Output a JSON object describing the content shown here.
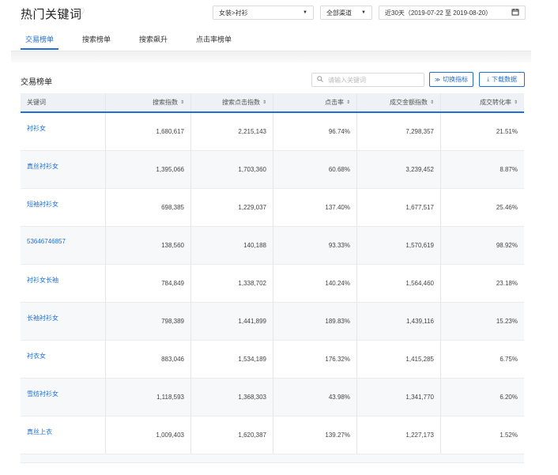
{
  "header": {
    "title": "热门关键词",
    "category": "女装>衬衫",
    "channel": "全部渠道",
    "date_range": "近30天（2019-07-22 至 2019-08-20）"
  },
  "tabs": [
    "交易榜单",
    "搜索榜单",
    "搜索飙升",
    "点击率榜单"
  ],
  "section": {
    "title": "交易榜单",
    "search_placeholder": "请输入关键词",
    "switch_label": "切换指标",
    "download_label": "下载数据"
  },
  "table": {
    "columns": [
      "关键词",
      "搜索指数",
      "搜索点击指数",
      "点击率",
      "成交金额指数",
      "成交转化率"
    ],
    "rows": [
      [
        "衬衫女",
        "1,680,617",
        "2,215,143",
        "96.74%",
        "7,298,357",
        "21.51%"
      ],
      [
        "真丝衬衫女",
        "1,395,066",
        "1,703,360",
        "60.68%",
        "3,239,452",
        "8.87%"
      ],
      [
        "短袖衬衫女",
        "698,385",
        "1,229,037",
        "137.40%",
        "1,677,517",
        "25.46%"
      ],
      [
        "53646746857",
        "138,560",
        "140,188",
        "93.33%",
        "1,570,619",
        "98.92%"
      ],
      [
        "衬衫女长袖",
        "784,849",
        "1,338,702",
        "140.24%",
        "1,564,460",
        "23.18%"
      ],
      [
        "长袖衬衫女",
        "798,389",
        "1,441,899",
        "189.83%",
        "1,439,116",
        "15.23%"
      ],
      [
        "衬衣女",
        "883,046",
        "1,534,189",
        "176.32%",
        "1,415,285",
        "6.75%"
      ],
      [
        "雪纺衬衫女",
        "1,118,593",
        "1,368,303",
        "43.98%",
        "1,341,770",
        "6.20%"
      ],
      [
        "真丝上衣",
        "1,009,403",
        "1,620,387",
        "139.27%",
        "1,227,173",
        "1.52%"
      ]
    ]
  },
  "colors": {
    "accent": "#1f6fd6",
    "header_bg": "#eef1f5",
    "alt_row_bg": "#f7f8fa"
  },
  "icons": [
    "heart-icon",
    "caret-down-icon",
    "calendar-icon",
    "search-icon",
    "double-chevron-down-icon",
    "download-icon",
    "sort-icon"
  ]
}
